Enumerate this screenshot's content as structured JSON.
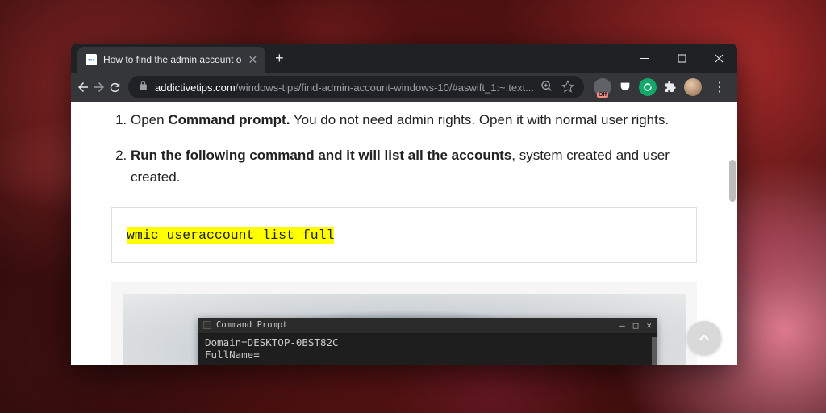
{
  "tab": {
    "title": "How to find the admin account o",
    "favicon_label": "•••"
  },
  "window_controls": {
    "minimize": "–",
    "maximize": "□",
    "close": "✕"
  },
  "toolbar": {
    "back": "←",
    "forward": "→",
    "reload": "⟳",
    "url_domain": "addictivetips.com",
    "url_path": "/windows-tips/find-admin-account-windows-10/#aswift_1:~:text...",
    "zoom": "⊕",
    "star": "☆"
  },
  "extensions": {
    "off_badge": "Off"
  },
  "article": {
    "step1_pre": "Open ",
    "step1_bold": "Command prompt.",
    "step1_post": " You do not need admin rights. Open it with normal user rights.",
    "step2_bold": "Run the following command and it will list all the accounts",
    "step2_post": ", system created and user created.",
    "command": "wmic useraccount list full"
  },
  "cmd_window": {
    "title": "Command Prompt",
    "line1": "Domain=DESKTOP-0BST82C",
    "line2": "FullName="
  }
}
